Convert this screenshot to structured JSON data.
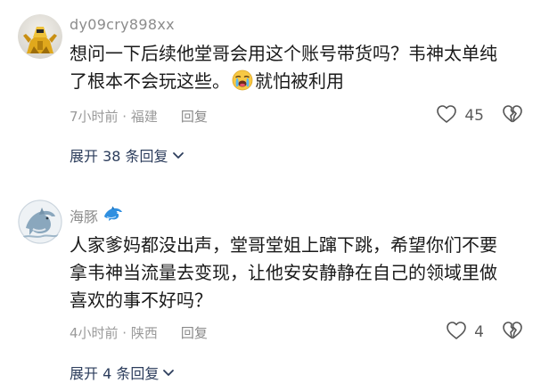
{
  "comments": [
    {
      "username": "dy09cry898xx",
      "content_lines": [
        "想问一下后续他堂哥会用这个账号带货吗？韦神太单纯",
        "了根本不会玩这些。",
        "就怕被利用"
      ],
      "emoji": "crying-face-emoji",
      "time": "7小时前 · 福建",
      "reply_label": "回复",
      "likes": "45",
      "expand_label": "展开 38 条回复"
    },
    {
      "username": "海豚",
      "username_icon": "dolphin-icon",
      "content_lines": [
        "人家爹妈都没出声，堂哥堂姐上蹿下跳，希望你们不要",
        "拿韦神当流量去变现，让他安安静静在自己的领域里做",
        "喜欢的事不好吗？"
      ],
      "time": "4小时前 · 陕西",
      "reply_label": "回复",
      "likes": "4",
      "expand_label": "展开 4 条回复"
    }
  ],
  "icons": {
    "like": "heart-outline-icon",
    "dislike": "broken-heart-outline-icon",
    "expand": "chevron-down-icon"
  },
  "colors": {
    "text": "#1a1a1a",
    "meta": "#9a9a9a",
    "link": "#2c3d5c"
  }
}
